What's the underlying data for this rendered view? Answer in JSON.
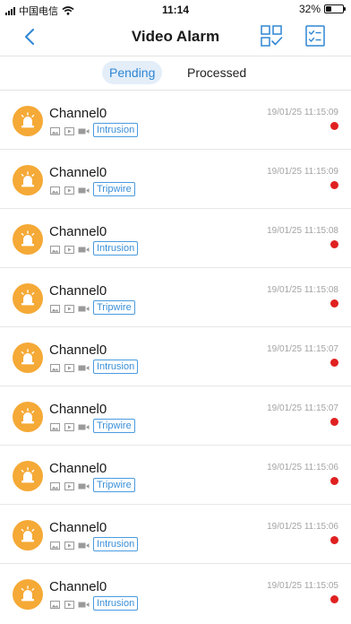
{
  "status_bar": {
    "carrier": "中国电信",
    "time": "11:14",
    "battery": "32%",
    "battery_level": 0.32
  },
  "header": {
    "title": "Video Alarm",
    "back_icon": "chevron-left-icon",
    "grid_icon": "grid-select-icon",
    "checklist_icon": "checklist-icon",
    "accent": "#2f86d4"
  },
  "tabs": [
    {
      "label": "Pending",
      "active": true
    },
    {
      "label": "Processed",
      "active": false
    }
  ],
  "alarms": [
    {
      "channel": "Channel0",
      "event": "Intrusion",
      "time": "19/01/25 11:15:09",
      "unread": true
    },
    {
      "channel": "Channel0",
      "event": "Tripwire",
      "time": "19/01/25 11:15:09",
      "unread": true
    },
    {
      "channel": "Channel0",
      "event": "Intrusion",
      "time": "19/01/25 11:15:08",
      "unread": true
    },
    {
      "channel": "Channel0",
      "event": "Tripwire",
      "time": "19/01/25 11:15:08",
      "unread": true
    },
    {
      "channel": "Channel0",
      "event": "Intrusion",
      "time": "19/01/25 11:15:07",
      "unread": true
    },
    {
      "channel": "Channel0",
      "event": "Tripwire",
      "time": "19/01/25 11:15:07",
      "unread": true
    },
    {
      "channel": "Channel0",
      "event": "Tripwire",
      "time": "19/01/25 11:15:06",
      "unread": true
    },
    {
      "channel": "Channel0",
      "event": "Intrusion",
      "time": "19/01/25 11:15:06",
      "unread": true
    },
    {
      "channel": "Channel0",
      "event": "Intrusion",
      "time": "19/01/25 11:15:05",
      "unread": true
    }
  ],
  "colors": {
    "avatar": "#f5a936",
    "unread_dot": "#e02020",
    "tag": "#3a8fd8"
  }
}
